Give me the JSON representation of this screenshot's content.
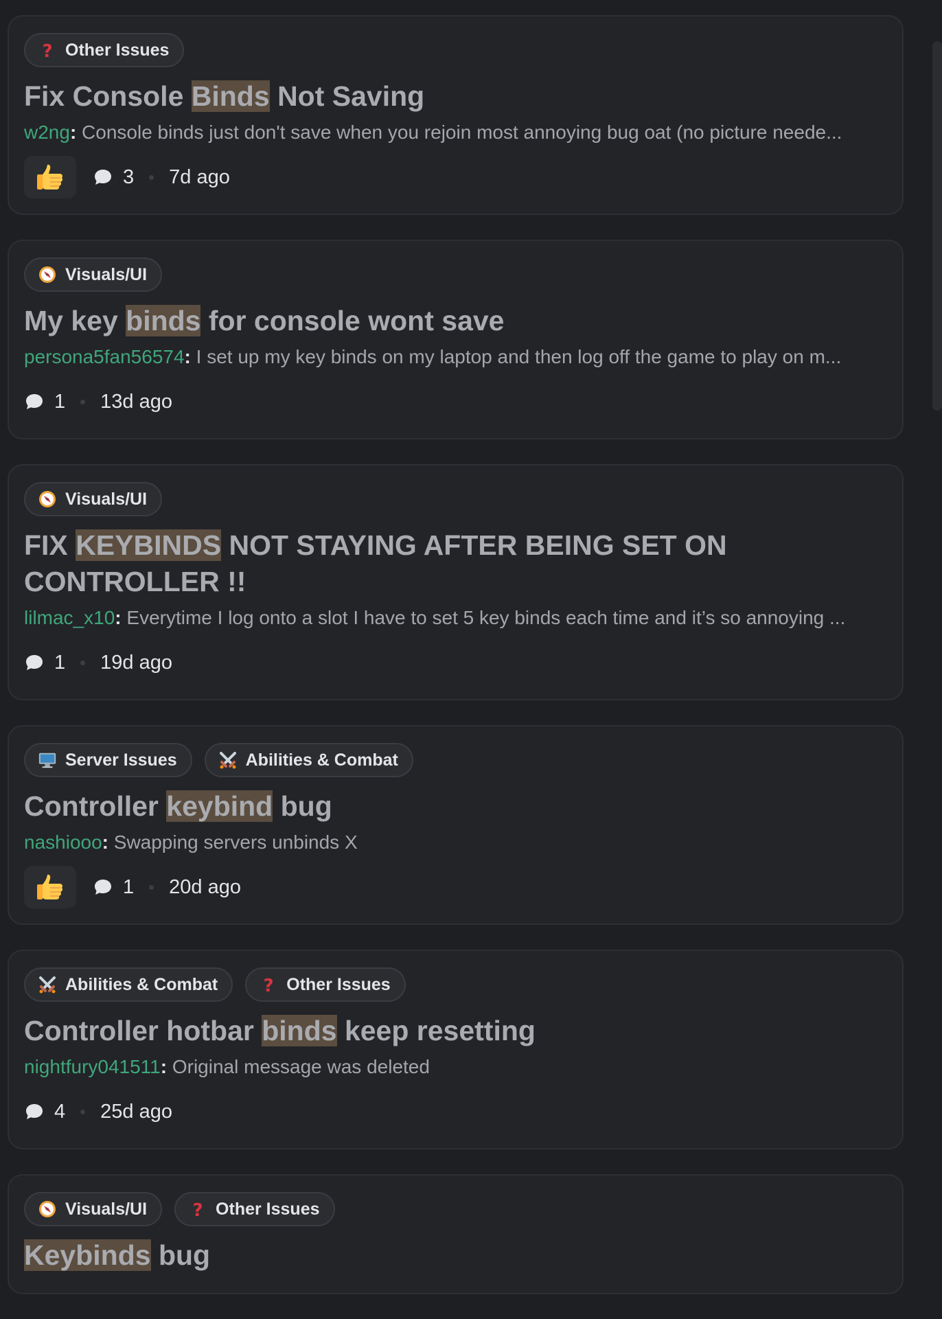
{
  "posts": [
    {
      "tags": [
        {
          "icon": "question-icon",
          "label": "Other Issues"
        }
      ],
      "title": [
        {
          "t": "Fix Console ",
          "h": false
        },
        {
          "t": "Binds",
          "h": true
        },
        {
          "t": " Not Saving",
          "h": false
        }
      ],
      "author": "w2ng",
      "snippet": "Console binds just don't save when you rejoin most annoying bug oat (no picture neede...",
      "reaction": "thumbs-up-icon",
      "comments": "3",
      "age": "7d ago"
    },
    {
      "tags": [
        {
          "icon": "compass-icon",
          "label": "Visuals/UI"
        }
      ],
      "title": [
        {
          "t": "My key ",
          "h": false
        },
        {
          "t": "binds",
          "h": true
        },
        {
          "t": " for console wont save",
          "h": false
        }
      ],
      "author": "persona5fan56574",
      "snippet": "I set up my key binds on my laptop and then log off the game to play on m...",
      "reaction": null,
      "comments": "1",
      "age": "13d ago"
    },
    {
      "tags": [
        {
          "icon": "compass-icon",
          "label": "Visuals/UI"
        }
      ],
      "title": [
        {
          "t": "FIX ",
          "h": false
        },
        {
          "t": "KEYBINDS",
          "h": true
        },
        {
          "t": " NOT STAYING AFTER BEING SET ON CONTROLLER !!",
          "h": false
        }
      ],
      "author": "lilmac_x10",
      "snippet": "Everytime I log onto a slot I have to set 5 key binds each time and it’s so annoying ...",
      "reaction": null,
      "comments": "1",
      "age": "19d ago"
    },
    {
      "tags": [
        {
          "icon": "monitor-icon",
          "label": "Server Issues"
        },
        {
          "icon": "crossed-swords-icon",
          "label": "Abilities & Combat"
        }
      ],
      "title": [
        {
          "t": "Controller ",
          "h": false
        },
        {
          "t": "keybind",
          "h": true
        },
        {
          "t": " bug",
          "h": false
        }
      ],
      "author": "nashiooo",
      "snippet": "Swapping servers unbinds X",
      "reaction": "thumbs-up-icon",
      "comments": "1",
      "age": "20d ago"
    },
    {
      "tags": [
        {
          "icon": "crossed-swords-icon",
          "label": "Abilities & Combat"
        },
        {
          "icon": "question-icon",
          "label": "Other Issues"
        }
      ],
      "title": [
        {
          "t": "Controller hotbar ",
          "h": false
        },
        {
          "t": "binds",
          "h": true
        },
        {
          "t": " keep resetting",
          "h": false
        }
      ],
      "author": "nightfury041511",
      "snippet": "Original message was deleted",
      "reaction": null,
      "comments": "4",
      "age": "25d ago"
    },
    {
      "tags": [
        {
          "icon": "compass-icon",
          "label": "Visuals/UI"
        },
        {
          "icon": "question-icon",
          "label": "Other Issues"
        }
      ],
      "title": [
        {
          "t": "Keybinds",
          "h": true
        },
        {
          "t": " bug",
          "h": false
        }
      ],
      "author": "",
      "snippet": "",
      "reaction": null,
      "comments": "",
      "age": ""
    }
  ]
}
